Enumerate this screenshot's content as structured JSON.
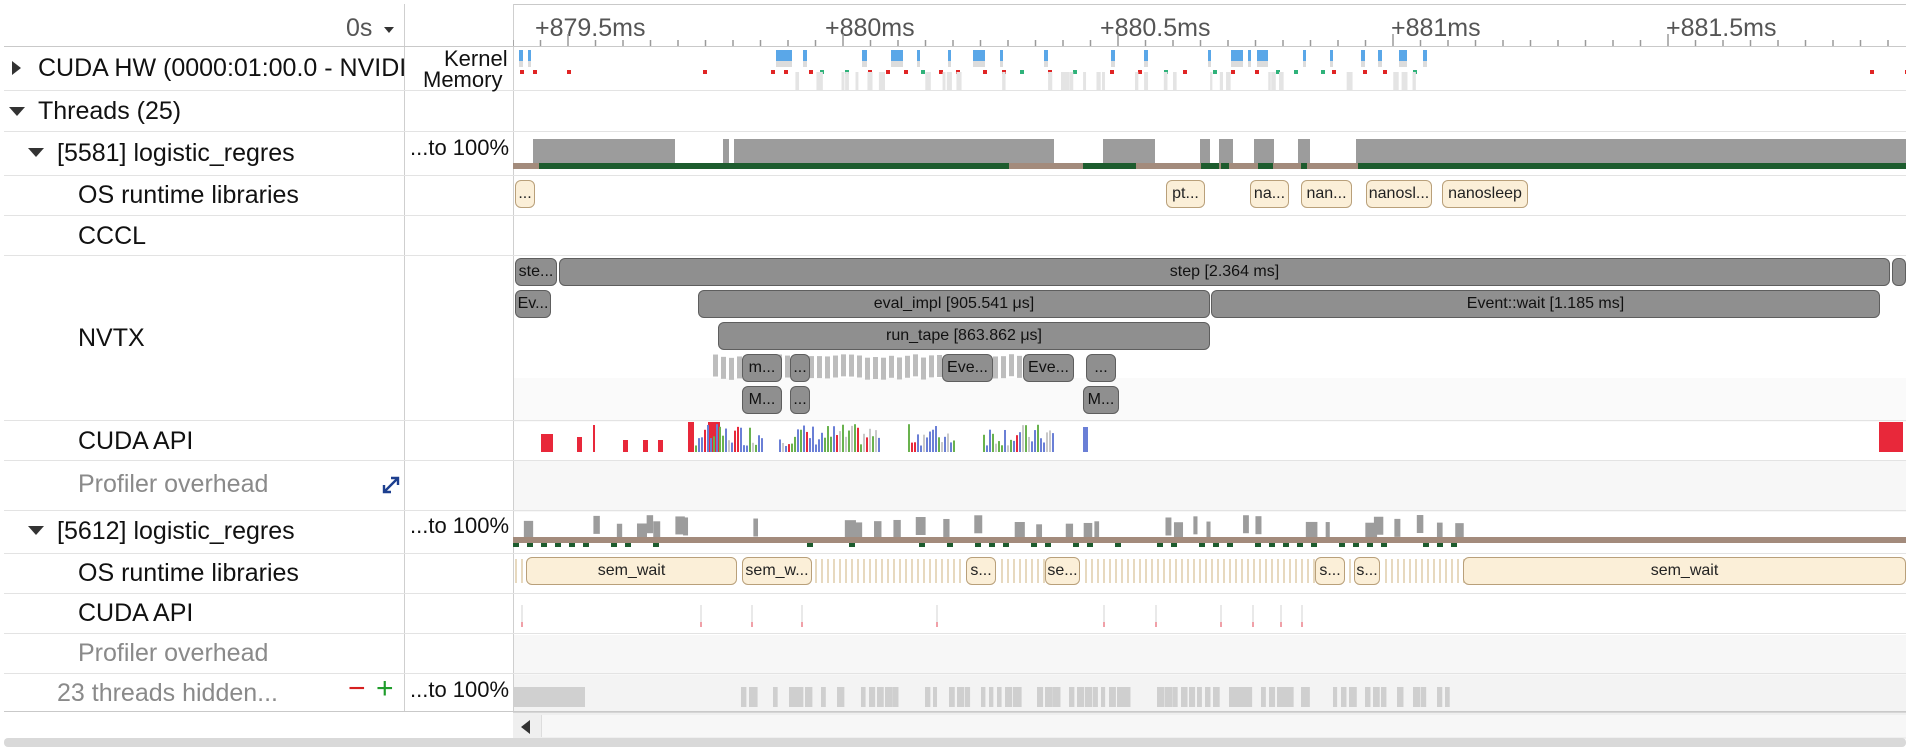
{
  "time_header": {
    "origin_label": "0s",
    "ticks": [
      "+879.5ms",
      "+880ms",
      "+880.5ms",
      "+881ms",
      "+881.5ms"
    ]
  },
  "tree": {
    "cuda_hw": "CUDA HW (0000:01:00.0 - NVIDI",
    "cuda_hw_sublabels": [
      "Kernel",
      "Memory"
    ],
    "threads": "Threads (25)",
    "proc1": {
      "name": "[5581] logistic_regres",
      "util": "...to 100%",
      "children": [
        "OS runtime libraries",
        "CCCL",
        "NVTX",
        "CUDA API",
        "Profiler overhead"
      ]
    },
    "proc2": {
      "name": "[5612] logistic_regres",
      "util": "...to 100%",
      "children": [
        "OS runtime libraries",
        "CUDA API",
        "Profiler overhead"
      ]
    },
    "hidden": "23 threads hidden...",
    "hidden_util": "...to 100%",
    "minus": "−",
    "plus": "+"
  },
  "nvtx": {
    "row1": [
      "ste...",
      "step [2.364 ms]"
    ],
    "row2": [
      "Ev...",
      "eval_impl [905.541 μs]",
      "Event::wait [1.185 ms]"
    ],
    "row3": [
      "run_tape [863.862 μs]"
    ],
    "row4": [
      "m...",
      "...",
      "Eve...",
      "Eve...",
      "..."
    ],
    "row5": [
      "M...",
      "...",
      "M..."
    ]
  },
  "os_runtime_1": [
    "...",
    "pt...",
    "na...",
    "nan...",
    "nanosl...",
    "nanosleep"
  ],
  "os_runtime_2": [
    "sem_wait",
    "sem_w...",
    "s...",
    "se...",
    "s...",
    "s...",
    "sem_wait"
  ],
  "colors": {
    "nvtx_fill": "#8f8f8f",
    "os_fill": "#fbefd8",
    "kernel_blue": "#5aa7e8",
    "memory_red": "#e02424",
    "memory_green": "#2fb27a",
    "thread_green": "#1d5c2e",
    "thread_brown": "#a38b7c",
    "cuda_api_red": "#e8283a",
    "cuda_api_blue": "#6a7fd6",
    "cuda_api_green": "#69b24e"
  }
}
